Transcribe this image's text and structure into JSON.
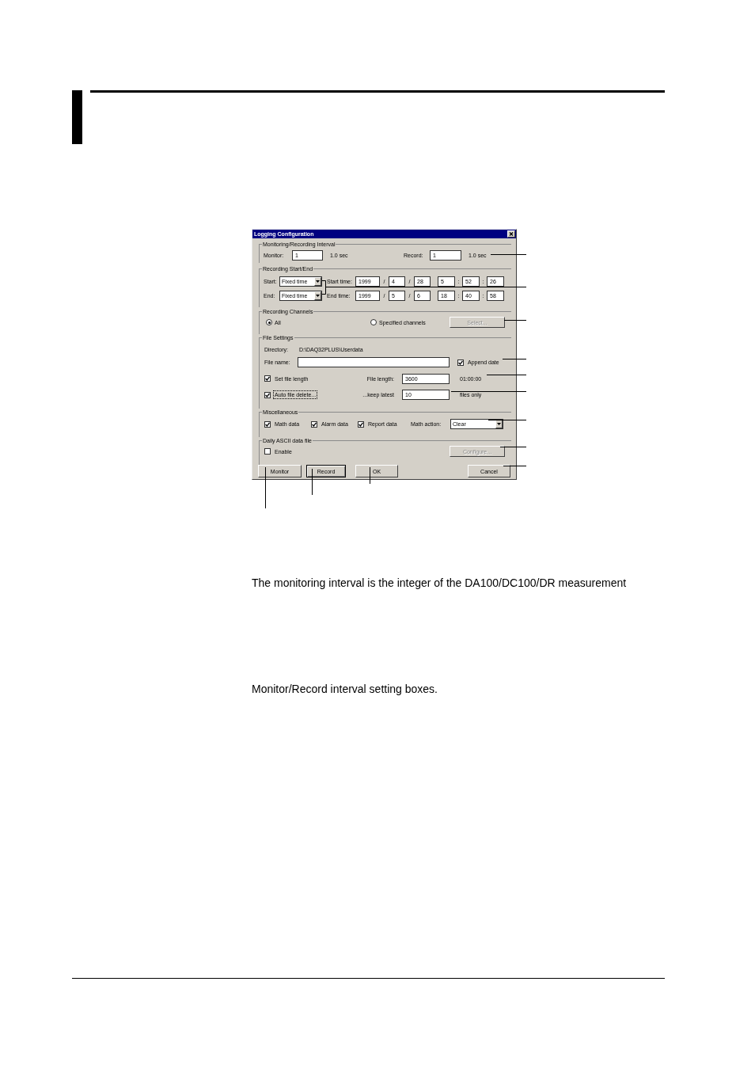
{
  "dialog": {
    "title": "Logging Configuration",
    "interval": {
      "label": "Monitoring/Recording Interval",
      "items": [
        {
          "label": "Monitor:",
          "value": "1",
          "unit": "1.0 sec"
        },
        {
          "label": "Record:",
          "value": "1",
          "unit": "1.0 sec"
        }
      ]
    },
    "start_end": {
      "label": "Recording Start/End",
      "rows": [
        {
          "label": "Start:",
          "mode": "Fixed time",
          "time_label": "Start time:",
          "date": [
            {
              "kind": "field",
              "value": "1999"
            },
            {
              "kind": "separator",
              "text": "/"
            },
            {
              "kind": "field",
              "value": "4"
            },
            {
              "kind": "separator",
              "text": "/"
            },
            {
              "kind": "field",
              "value": "28"
            }
          ],
          "time": [
            {
              "kind": "field",
              "value": "5"
            },
            {
              "kind": "separator",
              "text": ":"
            },
            {
              "kind": "field",
              "value": "52"
            },
            {
              "kind": "separator",
              "text": ":"
            },
            {
              "kind": "field",
              "value": "26"
            }
          ]
        },
        {
          "label": "End:",
          "mode": "Fixed time",
          "time_label": "End time:",
          "date": [
            {
              "kind": "field",
              "value": "1999"
            },
            {
              "kind": "separator",
              "text": "/"
            },
            {
              "kind": "field",
              "value": "5"
            },
            {
              "kind": "separator",
              "text": "/"
            },
            {
              "kind": "field",
              "value": "6"
            }
          ],
          "time": [
            {
              "kind": "field",
              "value": "18"
            },
            {
              "kind": "separator",
              "text": ":"
            },
            {
              "kind": "field",
              "value": "40"
            },
            {
              "kind": "separator",
              "text": ":"
            },
            {
              "kind": "field",
              "value": "58"
            }
          ]
        }
      ]
    },
    "channels": {
      "label": "Recording Channels",
      "options": [
        {
          "label": "All",
          "selected": true
        },
        {
          "label": "Specified channels",
          "selected": false
        }
      ],
      "button": {
        "label": "Select...",
        "disabled": true
      }
    },
    "file": {
      "label": "File Settings",
      "directory_label": "Directory:",
      "directory": "D:\\DAQ32PLUS\\Userdata",
      "name_label": "File name:",
      "append_date": {
        "label": "Append date",
        "checked": true
      },
      "rows": [
        {
          "label": "Set file length",
          "checked": true,
          "focused": false,
          "field_label": "File length:",
          "value": "3600",
          "note": "01:00:00"
        },
        {
          "label": "Auto file delete...",
          "checked": true,
          "focused": true,
          "field_label": "...keep latest",
          "value": "10",
          "note": "files only"
        }
      ]
    },
    "misc": {
      "label": "Miscellaneous",
      "checks": [
        {
          "label": "Math data",
          "checked": true
        },
        {
          "label": "Alarm data",
          "checked": true
        },
        {
          "label": "Report data",
          "checked": true
        }
      ],
      "action_label": "Math action:",
      "action": "Clear"
    },
    "daily": {
      "label": "Daily ASCII data file",
      "enable": {
        "label": "Enable",
        "checked": false
      },
      "button": {
        "label": "Configure...",
        "disabled": true
      }
    },
    "buttons": [
      {
        "label": "Monitor",
        "default": false
      },
      {
        "label": "Record",
        "default": true
      },
      {
        "label": "OK",
        "default": false
      },
      {
        "label": "Cancel",
        "default": false
      }
    ]
  },
  "paragraphs": [
    "The monitoring interval is the integer of the DA100/DC100/DR measurement",
    "Monitor/Record interval setting boxes."
  ]
}
